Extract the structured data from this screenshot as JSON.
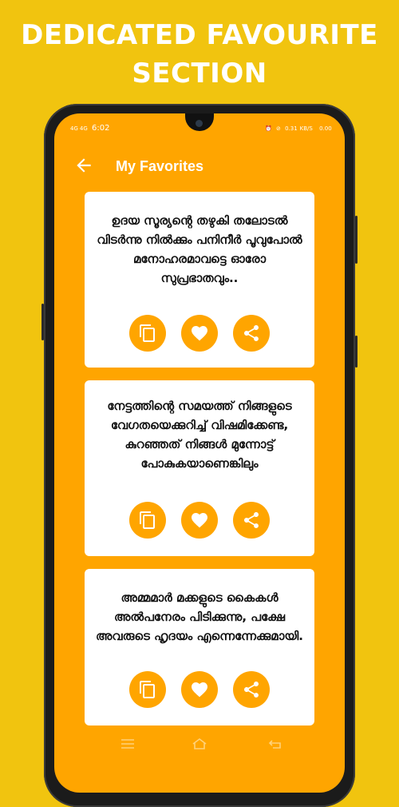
{
  "promo": {
    "headline_line1": "DEDICATED FAVOURITE",
    "headline_line2": "SECTION"
  },
  "status_bar": {
    "network1": "4G",
    "network2": "4G",
    "time": "6:02",
    "speed_value": "0.31",
    "speed_unit": "KB/S",
    "battery": "0.00"
  },
  "app_bar": {
    "back_icon": "arrow-back-icon",
    "title": "My Favorites"
  },
  "favorites": [
    {
      "quote": "ഉദയ സൂര്യന്റെ തഴുകി തലോടൽ വിടർന്നു നിൽക്കും പനിനീർ പൂവുപോൽ മനോഹരമാവട്ടെ ഓരോ സുപ്രഭാതവും.."
    },
    {
      "quote": "നേട്ടത്തിന്റെ സമയത്ത് നിങ്ങളുടെ വേഗതയെക്കുറിച്ച് വിഷമിക്കേണ്ട, കുറഞ്ഞത് നിങ്ങൾ മുന്നോട്ട് പോകുകയാണെങ്കിലും"
    },
    {
      "quote": "അമ്മമാർ മക്കളുടെ കൈകൾ അൽപനേരം പിടിക്കുന്നു, പക്ഷേ അവരുടെ ഹൃദയം എന്നെന്നേക്കുമായി."
    }
  ],
  "actions": {
    "copy_icon": "copy-icon",
    "favorite_icon": "heart-icon",
    "share_icon": "share-icon"
  },
  "colors": {
    "background": "#F1C40F",
    "screen": "#FFA500",
    "card": "#FFFFFF",
    "text": "#111111"
  },
  "nav_bar": {
    "menu_icon": "menu-icon",
    "home_icon": "home-icon",
    "back_icon": "back-icon"
  }
}
